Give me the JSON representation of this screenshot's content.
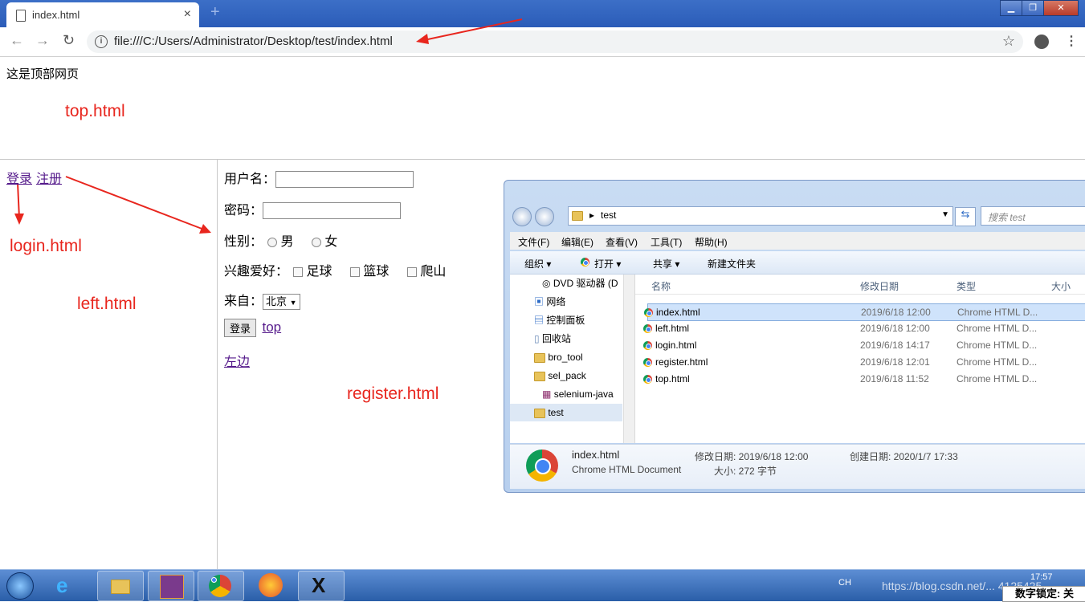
{
  "browser": {
    "tab_title": "index.html",
    "tab_close": "×",
    "new_tab": "+",
    "url": "file:///C:/Users/Administrator/Desktop/test/index.html",
    "info_glyph": "i",
    "back": "←",
    "forward": "→",
    "reload": "↻",
    "star": "☆",
    "menu": "⋮",
    "window_buttons": {
      "minimize": "▁",
      "maximize": "❐",
      "close": "✕"
    }
  },
  "top_frame": {
    "text": "这是顶部网页",
    "label": "top.html"
  },
  "left_frame": {
    "login_link": "登录",
    "register_link": "注册",
    "login_label": "login.html",
    "left_label": "left.html"
  },
  "form": {
    "username_label": "用户名：",
    "password_label": "密码：",
    "gender_label": "性别：",
    "gender_male": "男",
    "gender_female": "女",
    "hobby_label": "兴趣爱好：",
    "hobby_football": "足球",
    "hobby_basketball": "篮球",
    "hobby_climb": "爬山",
    "from_label": "来自：",
    "from_value": "北京",
    "login_button": "登录",
    "top_link": "top",
    "left_link": "左边",
    "register_label": "register.html"
  },
  "explorer": {
    "path": "test",
    "search_placeholder": "搜索 test",
    "menus": [
      "文件(F)",
      "编辑(E)",
      "查看(V)",
      "工具(T)",
      "帮助(H)"
    ],
    "commands": {
      "organize": "组织 ▾",
      "open": "打开 ▾",
      "share": "共享 ▾",
      "new_folder": "新建文件夹"
    },
    "nav_items": [
      "DVD 驱动器 (D",
      "网络",
      "控制面板",
      "回收站",
      "bro_tool",
      "sel_pack",
      "selenium-java",
      "test"
    ],
    "columns": {
      "name": "名称",
      "date": "修改日期",
      "type": "类型",
      "size": "大小"
    },
    "files": [
      {
        "name": "index.html",
        "date": "2019/6/18 12:00",
        "type": "Chrome HTML D..."
      },
      {
        "name": "left.html",
        "date": "2019/6/18 12:00",
        "type": "Chrome HTML D..."
      },
      {
        "name": "login.html",
        "date": "2019/6/18 14:17",
        "type": "Chrome HTML D..."
      },
      {
        "name": "register.html",
        "date": "2019/6/18 12:01",
        "type": "Chrome HTML D..."
      },
      {
        "name": "top.html",
        "date": "2019/6/18 11:52",
        "type": "Chrome HTML D..."
      }
    ],
    "details": {
      "file_name": "index.html",
      "file_type": "Chrome HTML Document",
      "modified": "修改日期: 2019/6/18 12:00",
      "size": "大小: 272 字节",
      "created": "创建日期: 2020/1/7 17:33"
    }
  },
  "taskbar": {
    "time": "17:57",
    "lang": "CH",
    "watermark": "https://blog.csdn.net/... 4125425",
    "numlock": "数字锁定: 关"
  },
  "colors": {
    "annotation": "#e8261e",
    "visited_link": "#551a8b",
    "taskbar": "#2a5ea8"
  }
}
